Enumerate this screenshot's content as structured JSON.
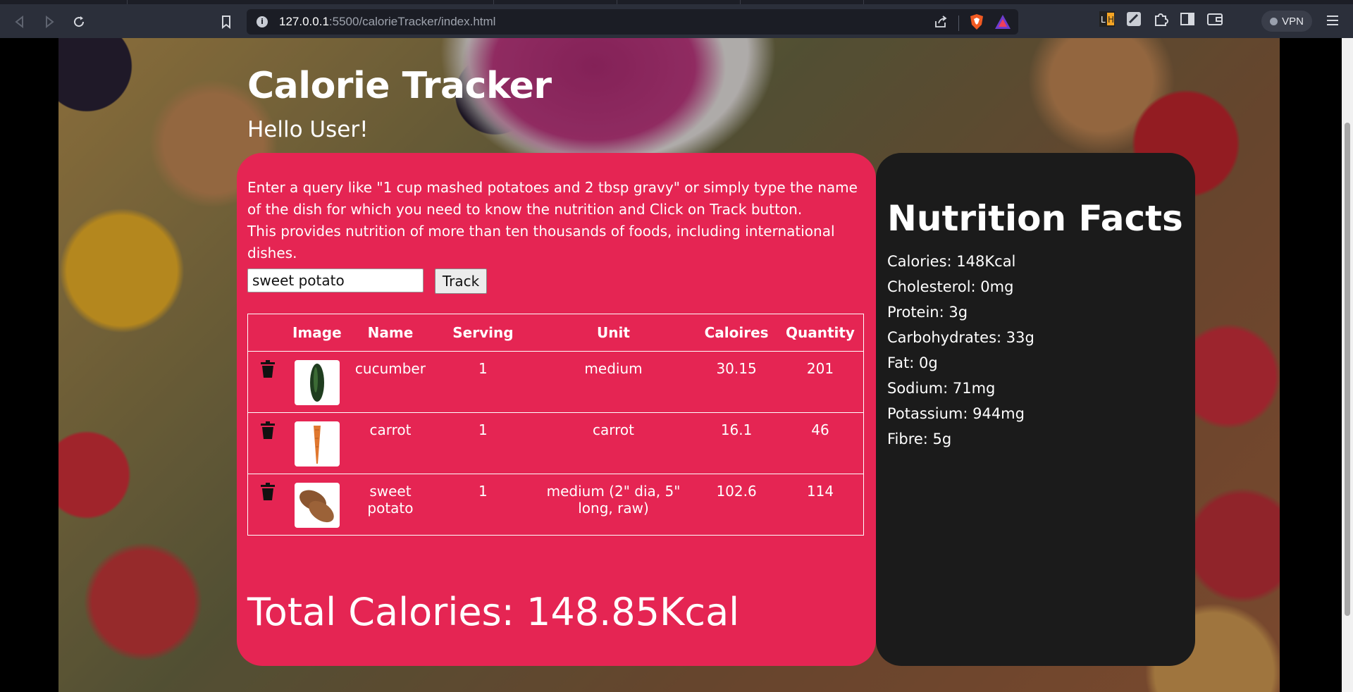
{
  "browser": {
    "url_host": "127.0.0.1",
    "url_path": ":5500/calorieTracker/index.html",
    "vpn_label": "VPN"
  },
  "page": {
    "title": "Calorie Tracker",
    "greeting": "Hello User!",
    "instructions": [
      "Enter a query like \"1 cup mashed potatoes and 2 tbsp gravy\" or simply type the name of the dish for which you need to know the nutrition and Click on Track button.",
      "This provides nutrition of more than ten thousands of foods, including international dishes."
    ],
    "search": {
      "value": "sweet potato",
      "button_label": "Track"
    },
    "table": {
      "headers": [
        "",
        "Image",
        "Name",
        "Serving",
        "Unit",
        "Caloires",
        "Quantity"
      ],
      "rows": [
        {
          "name": "cucumber",
          "serving": "1",
          "unit": "medium",
          "calories": "30.15",
          "quantity": "201",
          "image_icon": "cucumber-icon"
        },
        {
          "name": "carrot",
          "serving": "1",
          "unit": "carrot",
          "calories": "16.1",
          "quantity": "46",
          "image_icon": "carrot-icon"
        },
        {
          "name": "sweet potato",
          "serving": "1",
          "unit": "medium (2\" dia, 5\" long, raw)",
          "calories": "102.6",
          "quantity": "114",
          "image_icon": "sweet-potato-icon"
        }
      ]
    },
    "total_calories": "Total Calories: 148.85Kcal"
  },
  "nutrition": {
    "title": "Nutrition Facts",
    "facts": [
      "Calories: 148Kcal",
      "Cholesterol: 0mg",
      "Protein: 3g",
      "Carbohydrates: 33g",
      "Fat: 0g",
      "Sodium: 71mg",
      "Potassium: 944mg",
      "Fibre: 5g"
    ]
  },
  "colors": {
    "tracker_card": "#e52553",
    "nutrition_card": "#1b1b1b"
  }
}
